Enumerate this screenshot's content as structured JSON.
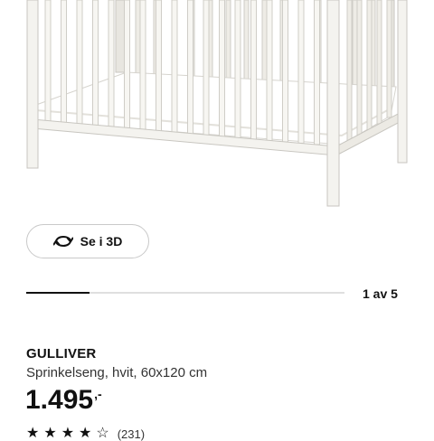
{
  "product": {
    "name": "GULLIVER",
    "description": "Sprinkelseng, hvit, 60x120 cm",
    "price_amount": "1.495",
    "price_suffix": ",-",
    "rating_value": 4,
    "rating_count": "(231)"
  },
  "gallery": {
    "view_3d_label": "Se i 3D",
    "counter": "1 av 5",
    "progress_fraction": 0.2
  },
  "icons": {
    "view_3d": "rotate-3d-icon",
    "star": "star-icon"
  },
  "colors": {
    "text": "#111111",
    "crib": "#f4f3ef",
    "border": "#c9c9c9",
    "track": "#dfdfdf"
  }
}
